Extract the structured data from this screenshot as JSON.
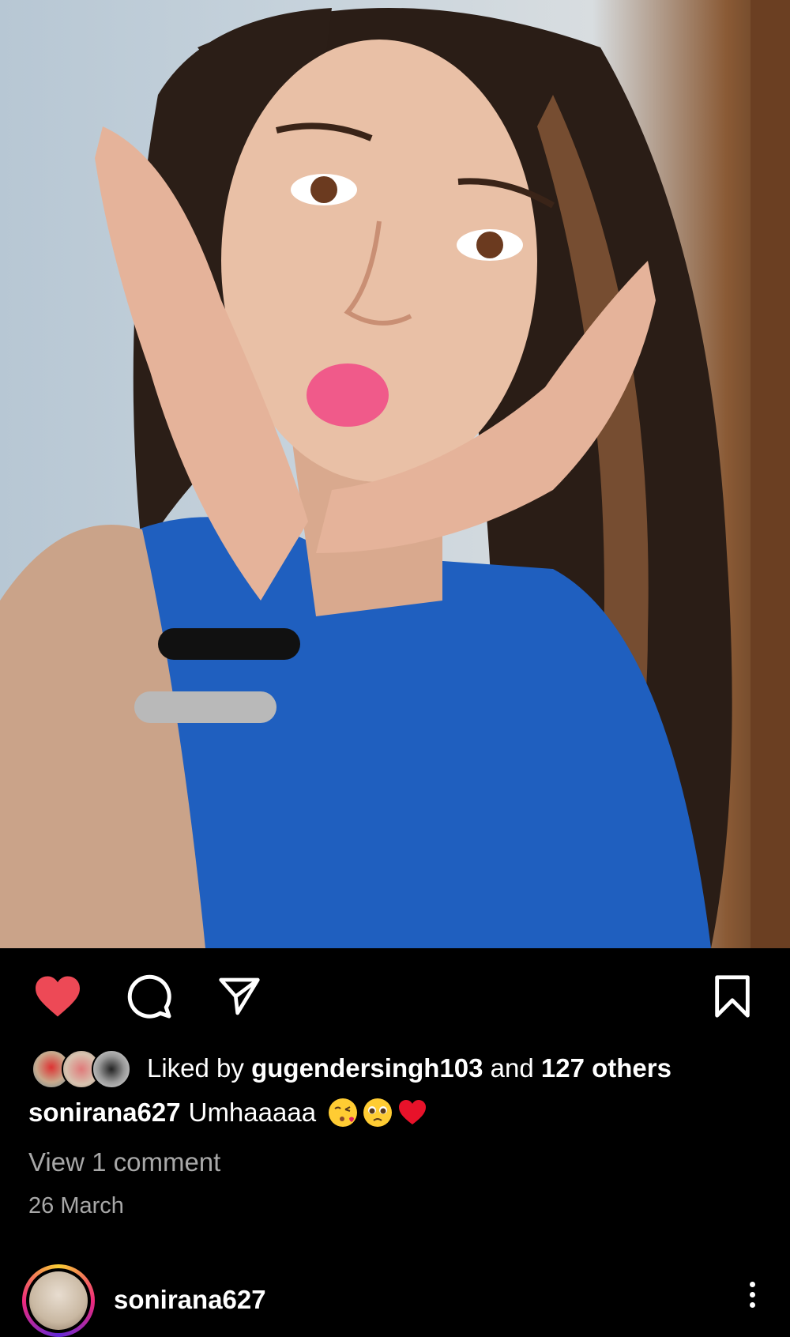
{
  "post": {
    "liked_by_prefix": "Liked by ",
    "liked_by_user": "gugendersingh103",
    "liked_by_and": " and ",
    "liked_by_others": "127 others",
    "caption_user": "sonirana627",
    "caption_text": "Umhaaaaa",
    "caption_emojis": [
      "face-blowing-kiss",
      "pleading-face",
      "red-heart"
    ],
    "view_comments": "View 1 comment",
    "date": "26 March"
  },
  "next_post": {
    "username": "sonirana627"
  },
  "icons": {
    "like": "heart-icon",
    "comment": "comment-icon",
    "share": "send-icon",
    "save": "bookmark-icon",
    "more": "more-vertical-icon"
  },
  "colors": {
    "like_active": "#ed4956",
    "muted_text": "#a8a8a8",
    "background": "#000000"
  }
}
